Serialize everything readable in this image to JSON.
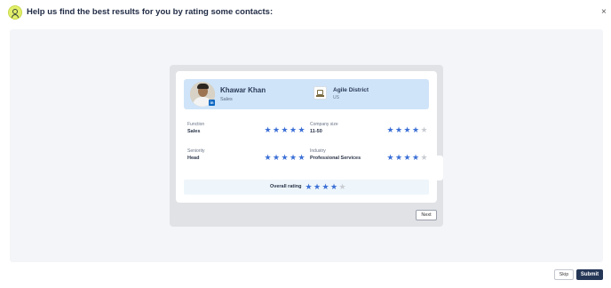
{
  "header": {
    "title": "Help us find the best results for you by rating some contacts:",
    "logo_icon": "contact-rating-logo-icon",
    "close_label": "×"
  },
  "contact": {
    "name": "Khawar Khan",
    "role": "Sales",
    "avatar_badge": "in",
    "company": "Agile District",
    "company_sub": "US"
  },
  "fields": [
    {
      "label": "Function",
      "value": "Sales",
      "rating": 5
    },
    {
      "label": "Company size",
      "value": "11-50",
      "rating": 4
    },
    {
      "label": "Seniority",
      "value": "Head",
      "rating": 5
    },
    {
      "label": "Industry",
      "value": "Professional Services",
      "rating": 4
    }
  ],
  "overall": {
    "label": "Overall rating",
    "rating": 4
  },
  "rating_max": 5,
  "star_glyph": "★",
  "colors": {
    "star_on": "#3b6fd6",
    "star_off": "#c9ccd2",
    "submit_bg": "#253757",
    "profile_bg": "#cfe4f8"
  },
  "buttons": {
    "next": "Next",
    "skip": "Skip",
    "submit": "Submit"
  }
}
